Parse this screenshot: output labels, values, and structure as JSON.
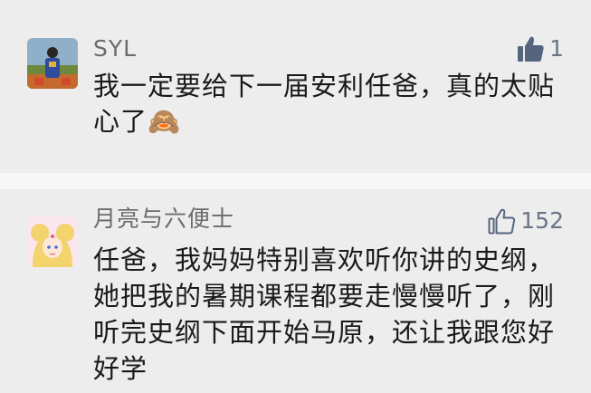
{
  "comments": [
    {
      "username": "SYL",
      "like_count": "1",
      "like_icon": "thumbs-up-filled-icon",
      "text": "我一定要给下一届安利任爸，真的太贴心了🙈",
      "avatar": "avatar-photo-person"
    },
    {
      "username": "月亮与六便士",
      "like_count": "152",
      "like_icon": "thumbs-up-outline-icon",
      "text": "任爸，我妈妈特别喜欢听你讲的史纲，她把我的暑期课程都要走慢慢听了，刚听完史纲下面开始马原，还让我跟您好好学",
      "avatar": "avatar-anime-sailor-moon"
    }
  ],
  "colors": {
    "background": "#f7f7f7",
    "card": "#ededed",
    "username": "#6b6b6b",
    "like_accent": "#56657e",
    "text": "#1a1a1a"
  }
}
